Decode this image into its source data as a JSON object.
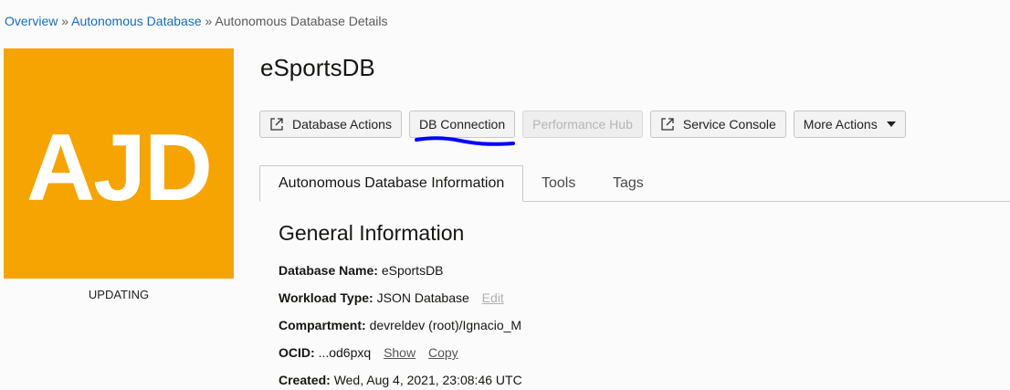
{
  "breadcrumb": {
    "items": [
      "Overview",
      "Autonomous Database"
    ],
    "current": "Autonomous Database Details",
    "separator": "»"
  },
  "logo": {
    "text": "AJD",
    "status": "UPDATING",
    "color": "#f5a402"
  },
  "title": "eSportsDB",
  "actions": {
    "database_actions": "Database Actions",
    "db_connection": "DB Connection",
    "performance_hub": "Performance Hub",
    "service_console": "Service Console",
    "more_actions": "More Actions"
  },
  "tabs": [
    "Autonomous Database Information",
    "Tools",
    "Tags"
  ],
  "section_title": "General Information",
  "info": {
    "database_name": {
      "label": "Database Name:",
      "value": "eSportsDB"
    },
    "workload_type": {
      "label": "Workload Type:",
      "value": "JSON Database",
      "edit": "Edit"
    },
    "compartment": {
      "label": "Compartment:",
      "value": "devreldev (root)/Ignacio_M"
    },
    "ocid": {
      "label": "OCID:",
      "value": "...od6pxq",
      "show": "Show",
      "copy": "Copy"
    },
    "created": {
      "label": "Created:",
      "value": "Wed, Aug 4, 2021, 23:08:46 UTC"
    }
  },
  "colors": {
    "link": "#1a6cb3",
    "annotation": "#0000ff"
  }
}
